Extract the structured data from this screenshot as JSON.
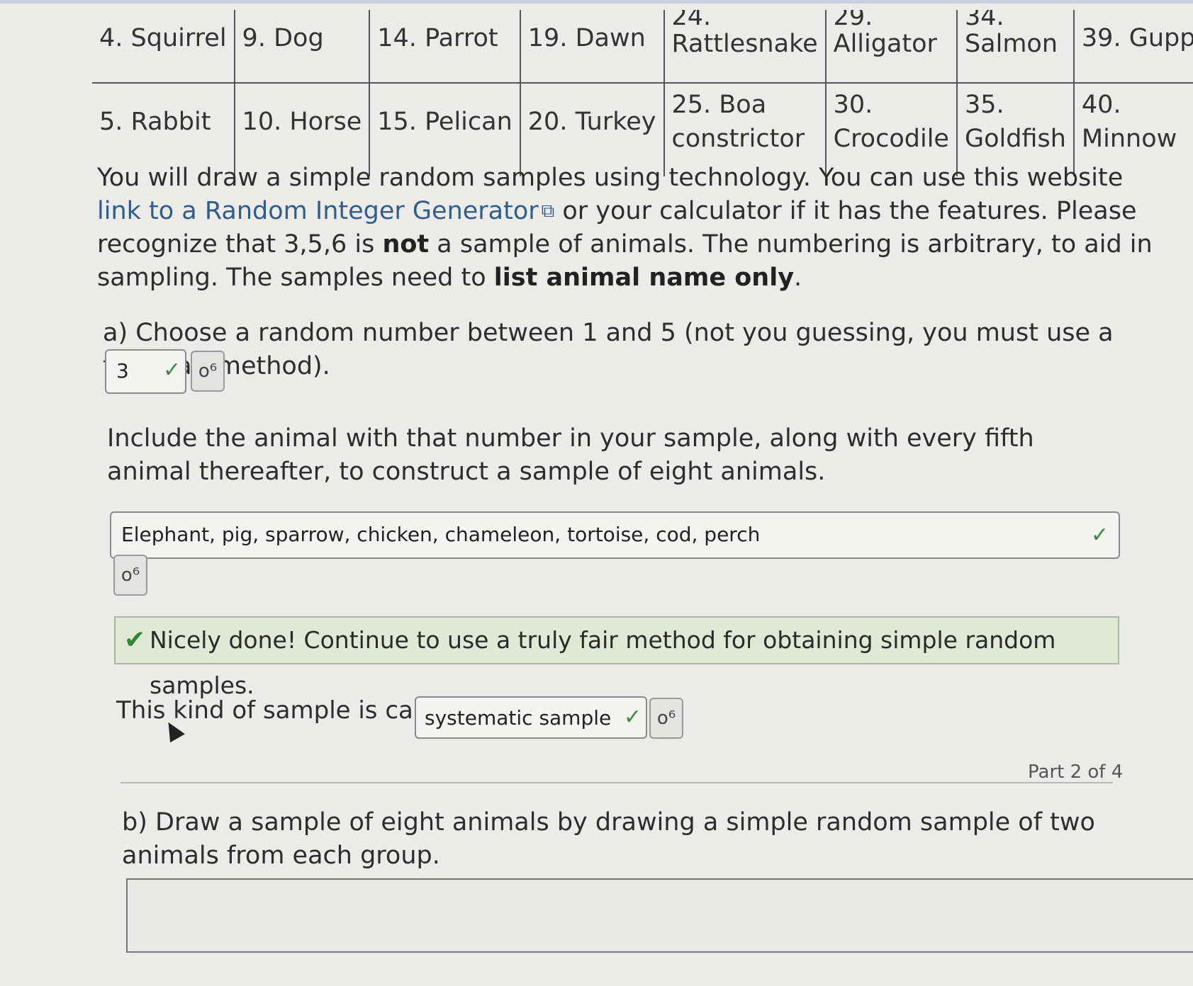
{
  "table": {
    "row1": [
      {
        "num": "4.",
        "name": "Squirrel",
        "split": false
      },
      {
        "num": "9.",
        "name": "Dog",
        "split": false
      },
      {
        "num": "14.",
        "name": "Parrot",
        "split": false
      },
      {
        "num": "19.",
        "name": "Dawn",
        "split": false
      },
      {
        "num": "24.",
        "name": "Rattlesnake",
        "split": true
      },
      {
        "num": "29.",
        "name": "Alligator",
        "split": true
      },
      {
        "num": "34.",
        "name": "Salmon",
        "split": true
      },
      {
        "num": "39.",
        "name": "Guppy",
        "split": false
      }
    ],
    "row2": [
      {
        "num": "5.",
        "name": "Rabbit",
        "split": false
      },
      {
        "num": "10.",
        "name": "Horse",
        "split": false
      },
      {
        "num": "15.",
        "name": "Pelican",
        "split": false
      },
      {
        "num": "20.",
        "name": "Turkey",
        "split": false
      },
      {
        "num": "25. Boa",
        "name": "constrictor",
        "split": true
      },
      {
        "num": "30.",
        "name": "Crocodile",
        "split": true
      },
      {
        "num": "35.",
        "name": "Goldfish",
        "split": true
      },
      {
        "num": "40.",
        "name": "Minnow",
        "split": true
      }
    ]
  },
  "intro": {
    "part1": "You will draw a simple random samples using technology. You can use this website ",
    "link": "link to a Random Integer Generator",
    "part2": " or your calculator if it has the features. Please recognize that 3,5,6 is ",
    "bold1": "not",
    "part3": " a sample of animals. The numbering is arbitrary, to aid in sampling. The samples need to ",
    "bold2": "list animal name only",
    "part4": "."
  },
  "question_a": "a) Choose a random number between 1 and 5 (not you guessing, you must use a truly fair method).",
  "answer_a": "3",
  "instruction": "Include the animal with that number in your sample, along with every fifth animal thereafter, to construct a sample of eight animals.",
  "sample_answer": "Elephant, pig, sparrow, chicken, chameleon, tortoise, cod, perch",
  "feedback": "Nicely done! Continue to use a truly fair method for obtaining simple random samples.",
  "kind_prefix": "This kind of sample is called a",
  "kind_answer": "systematic sample",
  "part_label": "Part 2 of 4",
  "question_b": "b) Draw a sample of eight animals by drawing a simple random sample of two animals from each group.",
  "icons": {
    "check": "✓",
    "key": "o⁶",
    "ext": "⧉",
    "feedback_ok": "✔"
  },
  "colors": {
    "check": "#3c8a3c",
    "link": "#2f5e8c",
    "feedback_bg": "#dfe9d6"
  }
}
